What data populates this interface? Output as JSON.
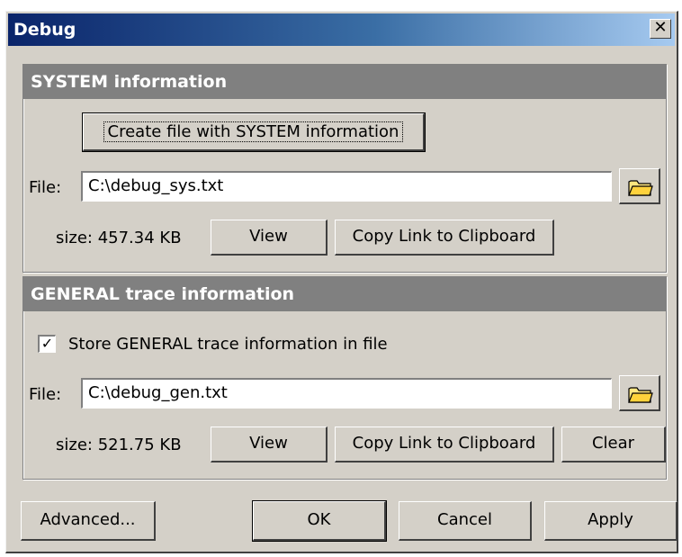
{
  "window": {
    "title": "Debug",
    "close_glyph": "✕"
  },
  "system": {
    "header": "SYSTEM information",
    "create_button": "Create file with SYSTEM information",
    "file_label": "File:",
    "file_value": "C:\\debug_sys.txt",
    "size_text": "size: 457.34 KB",
    "view_button": "View",
    "copy_button": "Copy Link to Clipboard"
  },
  "general": {
    "header": "GENERAL trace information",
    "checkbox_label": "Store GENERAL trace information in file",
    "checkbox_checked": true,
    "check_glyph": "✓",
    "file_label": "File:",
    "file_value": "C:\\debug_gen.txt",
    "size_text": "size: 521.75 KB",
    "view_button": "View",
    "copy_button": "Copy Link to Clipboard",
    "clear_button": "Clear"
  },
  "footer": {
    "advanced_button": "Advanced...",
    "ok_button": "OK",
    "cancel_button": "Cancel",
    "apply_button": "Apply"
  },
  "icons": {
    "folder": "folder-icon"
  }
}
